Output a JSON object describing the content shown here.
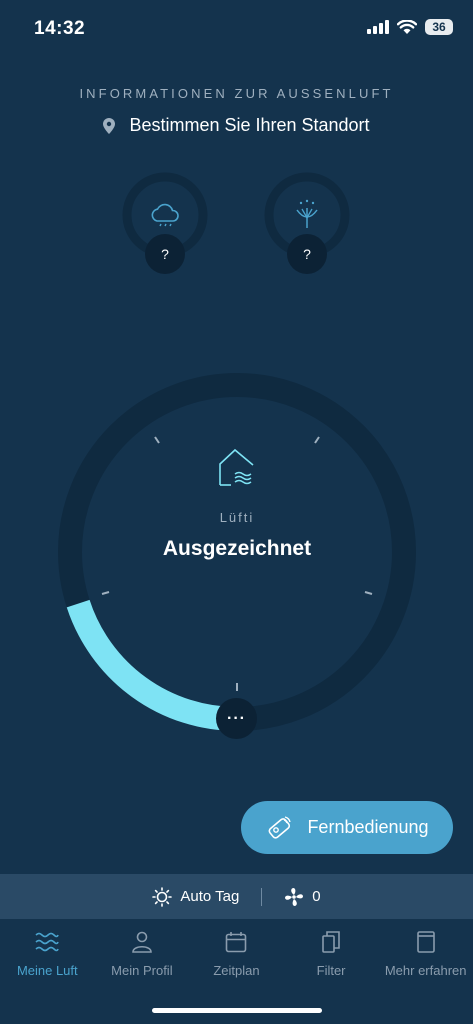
{
  "status": {
    "time": "14:32",
    "battery": "36"
  },
  "outside": {
    "title": "INFORMATIONEN ZUR AUSSENLUFT",
    "location": "Bestimmen Sie Ihren Standort",
    "weather_value": "?",
    "pollen_value": "?"
  },
  "gauge": {
    "subtitle": "Lüfti",
    "title": "Ausgezeichnet",
    "level": 0.2,
    "knob_label": "···"
  },
  "remote": {
    "label": "Fernbedienung"
  },
  "strip": {
    "mode": "Auto Tag",
    "fan_level": "0"
  },
  "tabs": [
    {
      "label": "Meine Luft",
      "icon": "waves-icon"
    },
    {
      "label": "Mein Profil",
      "icon": "person-icon"
    },
    {
      "label": "Zeitplan",
      "icon": "calendar-icon"
    },
    {
      "label": "Filter",
      "icon": "filter-icon"
    },
    {
      "label": "Mehr erfahren",
      "icon": "book-icon"
    }
  ],
  "colors": {
    "background": "#14334d",
    "accent": "#4aa3cd",
    "gauge_fill": "#7ee3f4",
    "track": "#0f2a40"
  }
}
